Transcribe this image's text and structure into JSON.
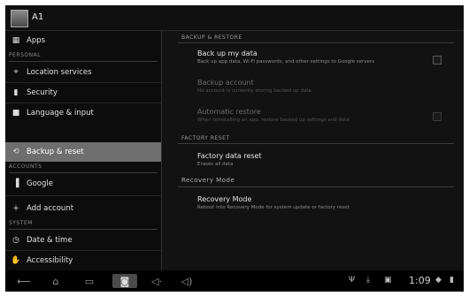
{
  "app": {
    "title": "A1"
  },
  "sidebar": {
    "items": [
      {
        "label": "Apps",
        "icon": "apps-icon"
      },
      {
        "label": "Location services",
        "icon": "location-icon"
      },
      {
        "label": "Security",
        "icon": "lock-icon"
      },
      {
        "label": "Language & input",
        "icon": "keyboard-icon"
      },
      {
        "label": "Backup & reset",
        "icon": "backup-icon"
      },
      {
        "label": "Google",
        "icon": "google-icon"
      },
      {
        "label": "Add account",
        "icon": "plus-icon"
      },
      {
        "label": "Date & time",
        "icon": "clock-icon"
      },
      {
        "label": "Accessibility",
        "icon": "accessibility-icon"
      }
    ],
    "headers": [
      "PERSONAL",
      "ACCOUNTS",
      "SYSTEM"
    ]
  },
  "content": {
    "section1": "BACKUP & RESTORE",
    "backup_title": "Back up my data",
    "backup_summary": "Back up app data, Wi-Fi passwords, and other settings to Google servers",
    "account_title": "Backup account",
    "account_summary": "No account is currently storing backed up data",
    "restore_title": "Automatic restore",
    "restore_summary": "When reinstalling an app, restore backed up settings and data",
    "section2": "FACTORY RESET",
    "reset_title": "Factory data reset",
    "reset_summary": "Erases all data",
    "section3": "Recovery Mode",
    "recovery_title": "Recovery Mode",
    "recovery_summary": "Reboot into Recovery Mode for system update or factory reset"
  },
  "navbar": {
    "clock": "1:09"
  },
  "colors": {
    "active_item": "#6e6e6e",
    "background": "#0a0a0a"
  }
}
